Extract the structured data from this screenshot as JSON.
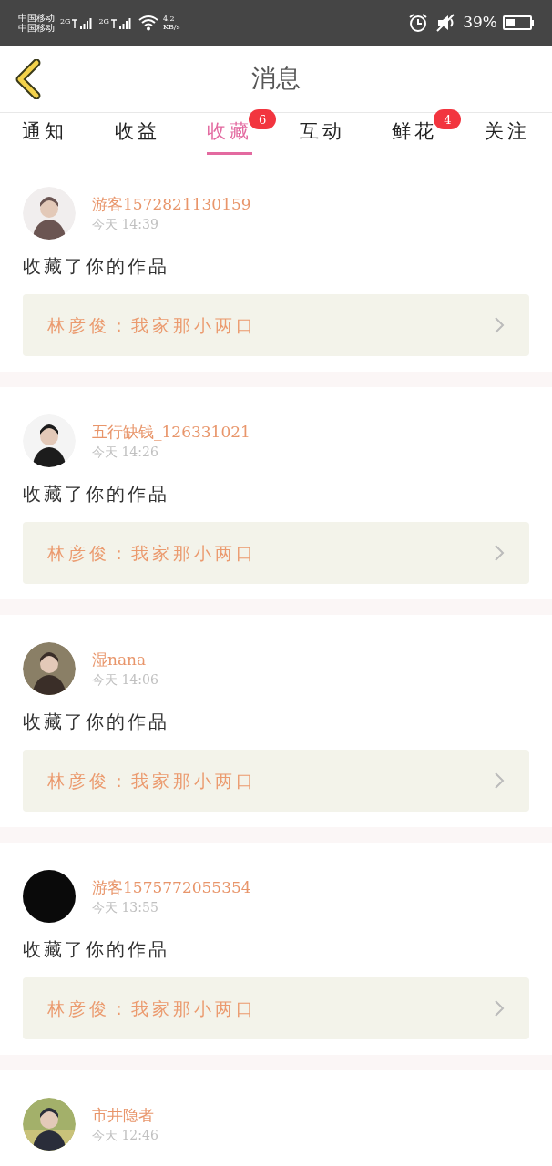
{
  "status_bar": {
    "carriers": [
      "中国移动",
      "中国移动"
    ],
    "networks": [
      "2G",
      "2G"
    ],
    "speed": "4.2",
    "speed_unit": "KB/s",
    "battery": "39%"
  },
  "header": {
    "title": "消息"
  },
  "tabs": [
    {
      "label": "通知",
      "selected": false
    },
    {
      "label": "收益",
      "selected": false
    },
    {
      "label": "收藏",
      "selected": true,
      "badge": "6"
    },
    {
      "label": "互动",
      "selected": false
    },
    {
      "label": "鲜花",
      "selected": false,
      "badge": "4"
    },
    {
      "label": "关注",
      "selected": false
    }
  ],
  "messages": [
    {
      "user": "游客1572821130159",
      "time": "今天 14:39",
      "action": "收藏了你的作品",
      "work": "林彦俊：我家那小两口"
    },
    {
      "user": "五行缺钱_126331021",
      "time": "今天 14:26",
      "action": "收藏了你的作品",
      "work": "林彦俊：我家那小两口"
    },
    {
      "user": "湿nana",
      "time": "今天 14:06",
      "action": "收藏了你的作品",
      "work": "林彦俊：我家那小两口"
    },
    {
      "user": "游客1575772055354",
      "time": "今天 13:55",
      "action": "收藏了你的作品",
      "work": "林彦俊：我家那小两口",
      "avatar": {
        "kind": "blank"
      }
    },
    {
      "user": "市井隐者",
      "time": "今天 12:46"
    }
  ]
}
